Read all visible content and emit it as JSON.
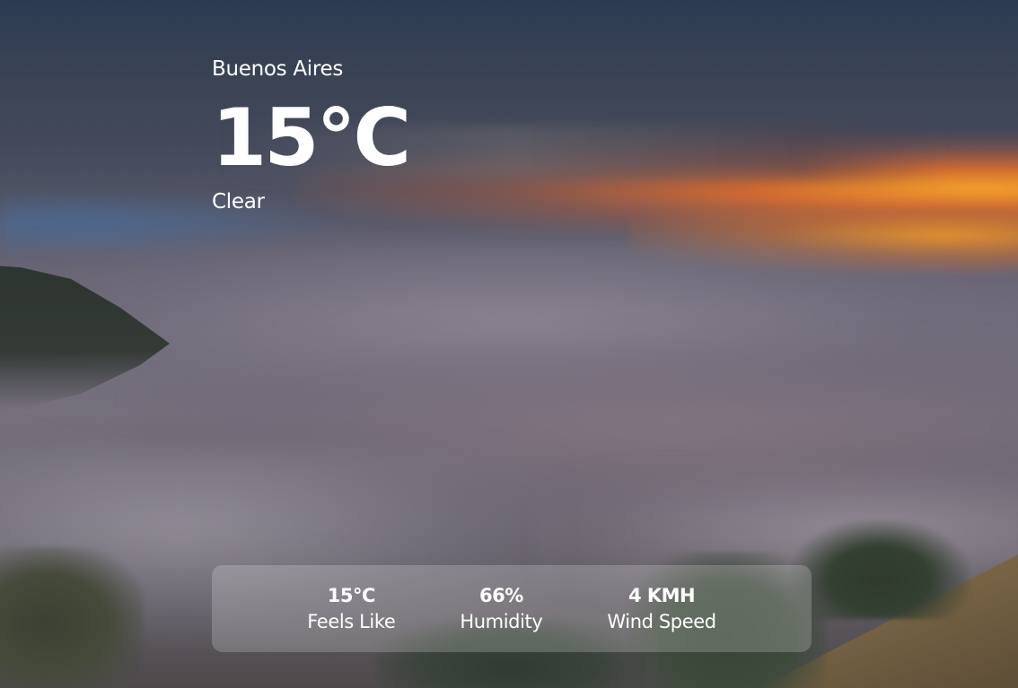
{
  "weather": {
    "city": "Buenos Aires",
    "temperature": "15°C",
    "condition": "Clear"
  },
  "stats": [
    {
      "value": "15°C",
      "label": "Feels Like"
    },
    {
      "value": "66%",
      "label": "Humidity"
    },
    {
      "value": "4 KMH",
      "label": "Wind Speed"
    }
  ]
}
